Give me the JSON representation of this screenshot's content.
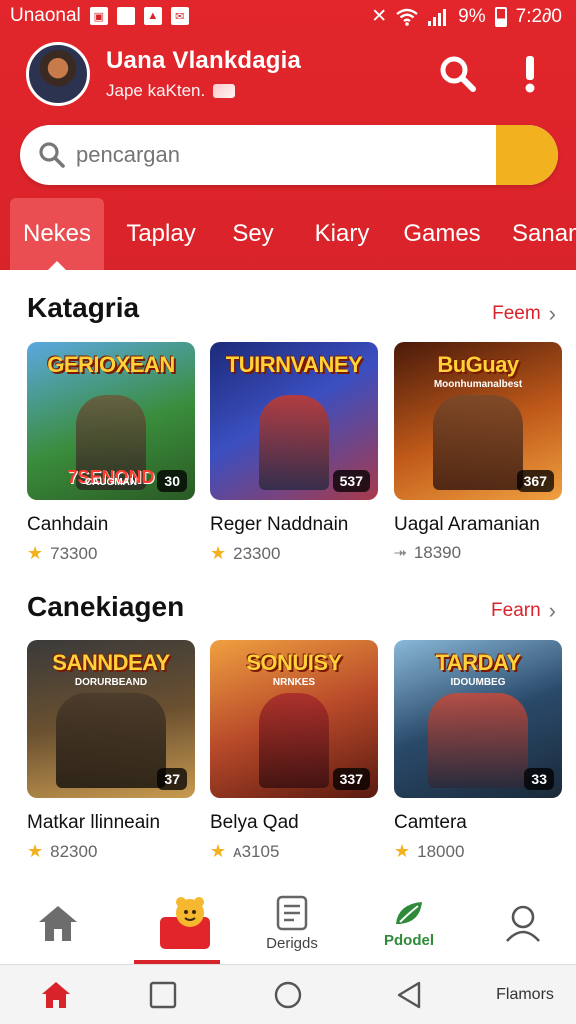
{
  "status_bar": {
    "carrier": "Unaonal",
    "battery": "9%",
    "time": "7:2∂0"
  },
  "profile": {
    "name": "Uana Vlankdagia",
    "subtitle": "Jape kaKten."
  },
  "search": {
    "placeholder": "pencargan"
  },
  "tabs": [
    {
      "label": "Nekes",
      "active": true
    },
    {
      "label": "Taрlay",
      "active": false
    },
    {
      "label": "Sey",
      "active": false
    },
    {
      "label": "Kiary",
      "active": false
    },
    {
      "label": "Games",
      "active": false
    },
    {
      "label": "Sanan",
      "active": false
    }
  ],
  "sections": [
    {
      "title": "Katagria",
      "see_all": "Feem",
      "cards": [
        {
          "art_title": "GERIOXEAN",
          "art_extra": "7SENOND",
          "art_sub": "CAUGMAN",
          "badge": "30",
          "name": "Canhdain",
          "rating": "73300",
          "rating_icon": "star-icon",
          "colors": [
            "#3a8d3c",
            "#8bc34a"
          ]
        },
        {
          "art_title": "TUIRNVANEY",
          "art_extra": "",
          "art_sub": "",
          "badge": "537",
          "name": "Reger Naddnain",
          "rating": "23300",
          "rating_icon": "star-icon",
          "colors": [
            "#2b3a9a",
            "#d64a3a"
          ]
        },
        {
          "art_title": "BuGuay",
          "art_extra": "",
          "art_sub": "Moonhumanalbest",
          "badge": "367",
          "name": "Uagal Aramanian",
          "rating": "18390",
          "rating_icon": "rank-icon",
          "colors": [
            "#7a2a12",
            "#e07a2a"
          ]
        }
      ]
    },
    {
      "title": "Canekiagen",
      "see_all": "Fearn",
      "cards": [
        {
          "art_title": "SANNDEAY",
          "art_extra": "",
          "art_sub": "DORURBEAND",
          "badge": "37",
          "name": "Matkar llinneain",
          "rating": "82300",
          "rating_icon": "star-icon",
          "colors": [
            "#4a3a2a",
            "#c8a060"
          ]
        },
        {
          "art_title": "SONUISY",
          "art_extra": "",
          "art_sub": "NRNKES",
          "badge": "337",
          "name": "Belya Qad",
          "rating": "ᴀ3105",
          "rating_icon": "star-icon",
          "colors": [
            "#8a2a1a",
            "#e08a40"
          ]
        },
        {
          "art_title": "TARDAY",
          "art_extra": "",
          "art_sub": "IDOUMBEG",
          "badge": "33",
          "name": "Camtera",
          "rating": "18000",
          "rating_icon": "star-icon",
          "colors": [
            "#1f3a5a",
            "#5aa0c0"
          ]
        }
      ]
    }
  ],
  "bottom_nav": [
    {
      "label": "",
      "icon": "home-icon",
      "active": false
    },
    {
      "label": "",
      "icon": "mascot-icon",
      "active": true
    },
    {
      "label": "Derigds",
      "icon": "document-icon",
      "active": false
    },
    {
      "label": "Pdodel",
      "icon": "leaf-icon",
      "active": false
    },
    {
      "label": "",
      "icon": "profile-icon",
      "active": false
    }
  ],
  "system_nav": {
    "extra_label": "Flamors"
  },
  "colors": {
    "brand_red": "#d9232a",
    "accent_yellow": "#f2b21f"
  }
}
